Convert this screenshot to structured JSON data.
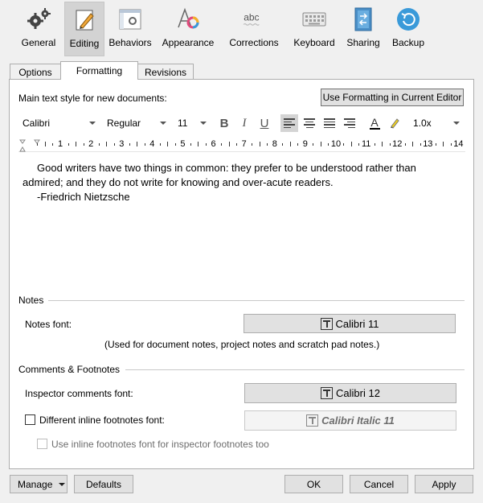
{
  "toolbar": {
    "items": [
      {
        "label": "General",
        "icon": "gears-icon"
      },
      {
        "label": "Editing",
        "icon": "pencil-document-icon"
      },
      {
        "label": "Behaviors",
        "icon": "window-gear-icon"
      },
      {
        "label": "Appearance",
        "icon": "font-color-icon"
      },
      {
        "label": "Corrections",
        "icon": "abc-spelling-icon"
      },
      {
        "label": "Keyboard",
        "icon": "keyboard-icon"
      },
      {
        "label": "Sharing",
        "icon": "share-document-icon"
      },
      {
        "label": "Backup",
        "icon": "backup-arrow-icon"
      }
    ],
    "active": "Editing"
  },
  "tabs": [
    "Options",
    "Formatting",
    "Revisions"
  ],
  "active_tab": "Formatting",
  "formatting": {
    "main_style_label": "Main text style for new documents:",
    "use_current_button": "Use Formatting in Current Editor",
    "font_family": "Calibri",
    "font_style": "Regular",
    "font_size": "11",
    "bold": "B",
    "italic": "I",
    "underline": "U",
    "text_color_glyph": "A",
    "line_spacing": "1.0x",
    "ruler_numbers": [
      "1",
      "2",
      "3",
      "4",
      "5",
      "6",
      "7",
      "8",
      "9",
      "10",
      "11",
      "12",
      "13",
      "14"
    ],
    "sample_line1": "Good writers have two things in common: they prefer to be understood rather than",
    "sample_line2": "admired; and they do not write for knowing and over-acute readers.",
    "sample_line3": "-Friedrich Nietzsche"
  },
  "notes": {
    "section": "Notes",
    "font_label": "Notes font:",
    "font_value": "Calibri 11",
    "hint": "(Used for document notes, project notes and scratch pad notes.)"
  },
  "comments": {
    "section": "Comments & Footnotes",
    "inspector_label": "Inspector comments font:",
    "inspector_value": "Calibri 12",
    "inline_label": "Different inline footnotes font:",
    "inline_value": "Calibri Italic 11",
    "inline_checked": false,
    "use_inline_label": "Use inline footnotes font for inspector footnotes too",
    "use_inline_checked": false
  },
  "footer": {
    "manage": "Manage",
    "defaults": "Defaults",
    "ok": "OK",
    "cancel": "Cancel",
    "apply": "Apply"
  },
  "colors": {
    "active_toolbar_bg": "#d3d3d3",
    "button_bg": "#e1e1e1",
    "highlighter": "#f2d21a",
    "backup_blue": "#3a9ad9"
  }
}
